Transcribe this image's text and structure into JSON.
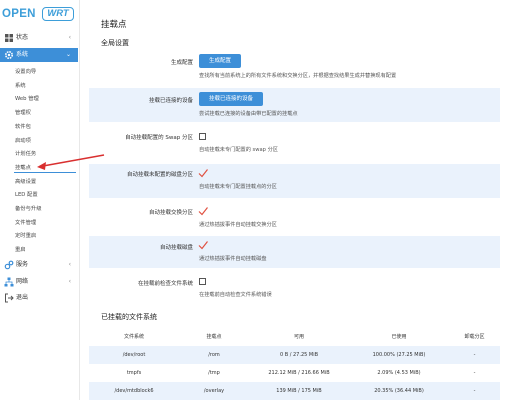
{
  "logo": {
    "open": "OPEN",
    "wrt": "WRT"
  },
  "sidebar": {
    "status": "状态",
    "system": "系统",
    "services": "服务",
    "network": "网络",
    "logout": "退出",
    "system_items": [
      "设置向导",
      "系统",
      "Web 管理",
      "管理权",
      "软件包",
      "启动项",
      "计划任务",
      "挂载点",
      "高级设置",
      "LED 配置",
      "备份与升级",
      "文件管理",
      "定时重启",
      "重启"
    ]
  },
  "main": {
    "title": "挂载点",
    "global_section": "全局设置",
    "rows": [
      {
        "label": "生成配置",
        "button": "生成配置",
        "desc": "查找所有当前系统上的所有文件系统和交换分区，并根据查找结果生成并替换现有配置"
      },
      {
        "label": "挂载已连接的设备",
        "button": "挂载已连接的设备",
        "desc": "尝试挂载已连接的设备由带已配置的挂载点"
      },
      {
        "label": "自动挂载配置的 Swap 分区",
        "desc": "自动挂载未专门配置的 swap 分区"
      },
      {
        "label": "自动挂载未配置的磁盘分区",
        "desc": "自动挂载未专门配置挂载点的分区"
      },
      {
        "label": "自动挂载交换分区",
        "desc": "通过热插拔事件自动挂载交换分区"
      },
      {
        "label": "自动挂载磁盘",
        "desc": "通过热插拔事件自动挂载磁盘"
      },
      {
        "label": "在挂载前检查文件系统",
        "desc": "在挂载前自动检查文件系统错误"
      }
    ],
    "mounted_section": "已挂载的文件系统",
    "table": {
      "headers": [
        "文件系统",
        "挂载点",
        "可用",
        "已使用",
        "卸载分区"
      ],
      "rows": [
        [
          "/dev/root",
          "/rom",
          "0 B / 27.25 MiB",
          "100.00% (27.25 MiB)",
          "-"
        ],
        [
          "tmpfs",
          "/tmp",
          "212.12 MiB / 216.66 MiB",
          "2.09% (4.53 MiB)",
          "-"
        ],
        [
          "/dev/mtdblock6",
          "/overlay",
          "139 MiB / 175 MiB",
          "20.35% (36.44 MiB)",
          "-"
        ]
      ]
    }
  },
  "colors": {
    "accent": "#3d8fd8",
    "highlight": "#eaf2fc",
    "check": "#e05040",
    "arrow": "#d93030"
  }
}
